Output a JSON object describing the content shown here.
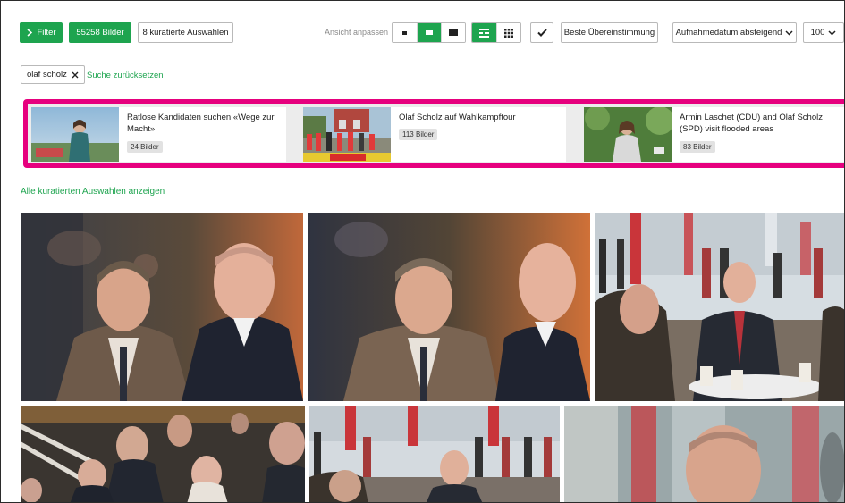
{
  "toolbar": {
    "filter_label": "Filter",
    "count_label": "55258 Bilder",
    "curated_label": "8 kuratierte Auswahlen",
    "view_label": "Ansicht anpassen",
    "best_match_label": "Beste Übereinstimmung",
    "sort_label": "Aufnahmedatum absteigend",
    "per_page_label": "100"
  },
  "search": {
    "chip_label": "olaf scholz",
    "reset_label": "Suche zurücksetzen"
  },
  "curated": {
    "cards": [
      {
        "title": "Ratlose Kandidaten suchen «Wege zur Macht»",
        "count": "24 Bilder"
      },
      {
        "title": "Olaf Scholz auf Wahlkampftour",
        "count": "113 Bilder"
      },
      {
        "title": "Armin Laschet (CDU) and Olaf Scholz (SPD) visit flooded areas",
        "count": "83 Bilder"
      }
    ],
    "show_all_label": "Alle kuratierten Auswahlen anzeigen"
  },
  "colors": {
    "accent": "#1ea44f",
    "highlight": "#e6007e"
  },
  "icons": {
    "filter": "chevron-right-icon",
    "check": "check-icon",
    "sort": "chevron-down-icon",
    "per_page": "chevron-down-icon",
    "chip_remove": "close-icon"
  }
}
